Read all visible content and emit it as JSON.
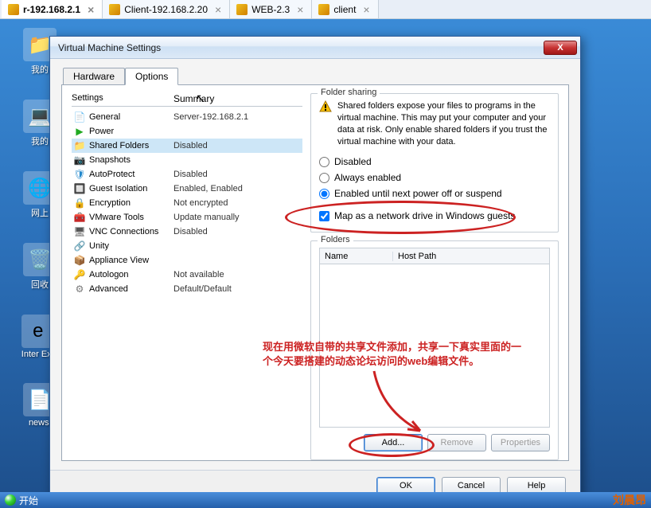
{
  "vm_tabs": [
    {
      "label": "r-192.168.2.1",
      "active": true
    },
    {
      "label": "Client-192.168.2.20",
      "active": false
    },
    {
      "label": "WEB-2.3",
      "active": false
    },
    {
      "label": "client",
      "active": false
    }
  ],
  "desktop_icons": [
    "我的",
    "我的",
    "网上",
    "回收",
    "Inter\nExpl",
    "newsi"
  ],
  "dialog": {
    "title": "Virtual Machine Settings"
  },
  "tabs": {
    "hardware": "Hardware",
    "options": "Options"
  },
  "settings_list": {
    "header_settings": "Settings",
    "header_summary": "Summary",
    "items": [
      {
        "name": "General",
        "summary": "Server-192.168.2.1",
        "icon": "general"
      },
      {
        "name": "Power",
        "summary": "",
        "icon": "power"
      },
      {
        "name": "Shared Folders",
        "summary": "Disabled",
        "icon": "folder",
        "selected": true
      },
      {
        "name": "Snapshots",
        "summary": "",
        "icon": "snapshot"
      },
      {
        "name": "AutoProtect",
        "summary": "Disabled",
        "icon": "shield"
      },
      {
        "name": "Guest Isolation",
        "summary": "Enabled, Enabled",
        "icon": "isolation"
      },
      {
        "name": "Encryption",
        "summary": "Not encrypted",
        "icon": "lock"
      },
      {
        "name": "VMware Tools",
        "summary": "Update manually",
        "icon": "tools"
      },
      {
        "name": "VNC Connections",
        "summary": "Disabled",
        "icon": "vnc"
      },
      {
        "name": "Unity",
        "summary": "",
        "icon": "unity"
      },
      {
        "name": "Appliance View",
        "summary": "",
        "icon": "appliance"
      },
      {
        "name": "Autologon",
        "summary": "Not available",
        "icon": "key"
      },
      {
        "name": "Advanced",
        "summary": "Default/Default",
        "icon": "advanced"
      }
    ]
  },
  "folder_sharing": {
    "group_label": "Folder sharing",
    "warning": "Shared folders expose your files to programs in the virtual machine. This may put your computer and your data at risk. Only enable shared folders if you trust the virtual machine with your data.",
    "radio_disabled": "Disabled",
    "radio_always": "Always enabled",
    "radio_until": "Enabled until next power off or suspend",
    "selected": "until",
    "checkbox_map": "Map as a network drive in Windows guests",
    "checkbox_map_checked": true
  },
  "folders": {
    "group_label": "Folders",
    "col_name": "Name",
    "col_host": "Host Path",
    "btn_add": "Add...",
    "btn_remove": "Remove",
    "btn_props": "Properties"
  },
  "footer": {
    "ok": "OK",
    "cancel": "Cancel",
    "help": "Help"
  },
  "annotation": {
    "text": "现在用微软自带的共享文件添加，共享一下真实里面的一个今天要搭建的动态论坛访问的web编辑文件。"
  },
  "taskbar": {
    "start": "开始",
    "watermark": "刘晨昂"
  }
}
